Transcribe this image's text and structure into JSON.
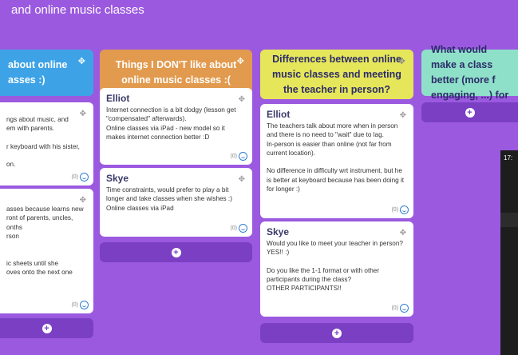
{
  "board": {
    "title": "and online music classes"
  },
  "columns": [
    {
      "title": "about online\nasses :)",
      "color": "#3ea3e6",
      "text_color": "#ffffff"
    },
    {
      "title": "Things I DON'T like about online music classes :(",
      "color": "#e29a4e",
      "text_color": "#ffffff"
    },
    {
      "title": "Differences between online music classes and meeting the teacher in person?",
      "color": "#e6e65a",
      "text_color": "#2c2c6a"
    },
    {
      "title": "What would make a class better (more f engaging, ...) for",
      "color": "#8fe0c8",
      "text_color": "#2c2c6a"
    }
  ],
  "cards": {
    "c1a": {
      "author": "",
      "body": "ngs about music, and\nem with parents.\n\nr keyboard with his sister,\n\non.",
      "reactions": "(0)"
    },
    "c1b": {
      "author": "",
      "body": "asses because learns new\nront of parents, uncles,\nonths\nrson\n\n\nic sheets until she\noves onto the next one",
      "reactions": "(0)"
    },
    "c2a": {
      "author": "Elliot",
      "body": "Internet connection is a bit dodgy (lesson get \"compensated\" afterwards).\nOnline classes via iPad - new model so it makes internet connection better :D",
      "reactions": "(0)"
    },
    "c2b": {
      "author": "Skye",
      "body": "Time constraints, would prefer to play a bit longer and take classes when she wishes :)\nOnline classes via iPad",
      "reactions": "(0)"
    },
    "c3a": {
      "author": "Elliot",
      "body": "The teachers talk about more when in person and there is no need to \"wait\" due to lag.\nIn-person is easier than online (not far from current location).\n\nNo difference in difficulty wrt instrument, but he is better at keyboard because has been doing it for longer :)",
      "reactions": "(0)"
    },
    "c3b": {
      "author": "Skye",
      "body": "Would you like to meet your teacher in person?\nYES!! :)\n\nDo you like the 1-1 format or with other participants during the class?\nOTHER PARTICIPANTS!!",
      "reactions": "(0)"
    }
  },
  "add_icon": "plus-circle-icon",
  "video": {
    "time": "17:"
  }
}
